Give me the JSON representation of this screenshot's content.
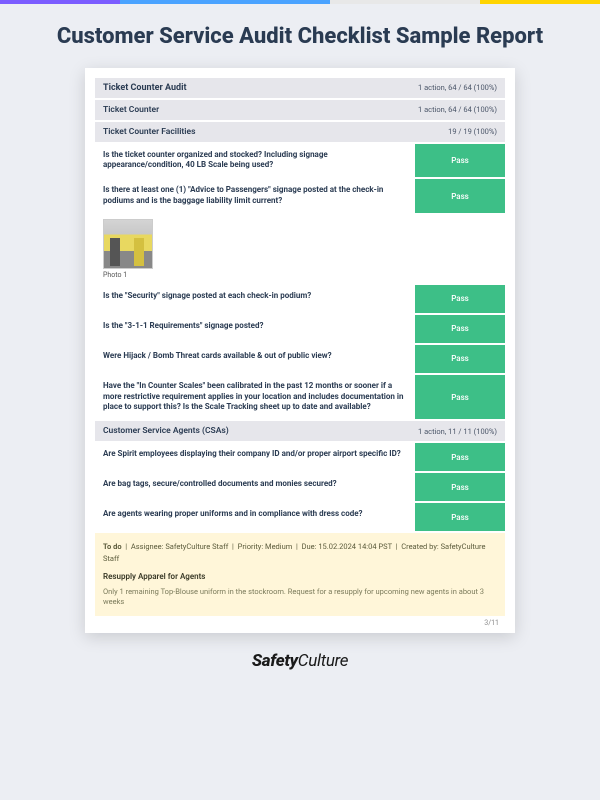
{
  "page_title": "Customer Service Audit Checklist Sample Report",
  "sections": [
    {
      "title": "Ticket Counter Audit",
      "meta": "1 action, 64 / 64 (100%)",
      "level": "top"
    },
    {
      "title": "Ticket Counter",
      "meta": "1 action, 64 / 64 (100%)",
      "level": "sub"
    },
    {
      "title": "Ticket Counter Facilities",
      "meta": "19 / 19 (100%)",
      "level": "sub"
    }
  ],
  "items_a": [
    {
      "q": "Is the ticket counter organized and stocked?  Including signage appearance/condition, 40 LB  Scale being used?",
      "r": "Pass"
    },
    {
      "q": "Is there at least one (1)  \"Advice to Passengers\" signage posted at the check-in podiums and is the baggage liability limit current?",
      "r": "Pass"
    }
  ],
  "photo_label": "Photo 1",
  "items_b": [
    {
      "q": "Is the \"Security\" signage posted at each check-in podium?",
      "r": "Pass"
    },
    {
      "q": "Is the \"3-1-1 Requirements\" signage posted?",
      "r": "Pass"
    },
    {
      "q": "Were Hijack / Bomb Threat cards available & out of public view?",
      "r": "Pass"
    },
    {
      "q": "Have the \"In Counter Scales\" been calibrated in the past 12 months or sooner if a more restrictive requirement applies in your location and includes documentation in place to support this? Is the Scale Tracking sheet up to date and available?",
      "r": "Pass"
    }
  ],
  "section_csa": {
    "title": "Customer Service Agents (CSAs)",
    "meta": "1 action, 11 / 11 (100%)"
  },
  "items_c": [
    {
      "q": "Are Spirit employees displaying their company ID and/or proper airport specific ID?",
      "r": "Pass"
    },
    {
      "q": "Are bag tags, secure/controlled documents and monies secured?",
      "r": "Pass"
    },
    {
      "q": "Are agents wearing proper uniforms and in compliance with dress code?",
      "r": "Pass"
    }
  ],
  "todo": {
    "status": "To do",
    "assignee": "SafetyCulture Staff",
    "priority": "Medium",
    "due": "15.02.2024 14:04 PST",
    "created_by": "SafetyCulture Staff",
    "title": "Resupply Apparel for Agents",
    "desc": "Only 1 remaining Top-Blouse uniform in the stockroom. Request for a resupply for upcoming new agents in about 3 weeks"
  },
  "labels": {
    "assignee": "Assignee:",
    "priority": "Priority:",
    "due": "Due:",
    "created_by": "Created by:"
  },
  "page_num": "3/11",
  "brand": {
    "bold": "Safety",
    "light": "Culture"
  }
}
